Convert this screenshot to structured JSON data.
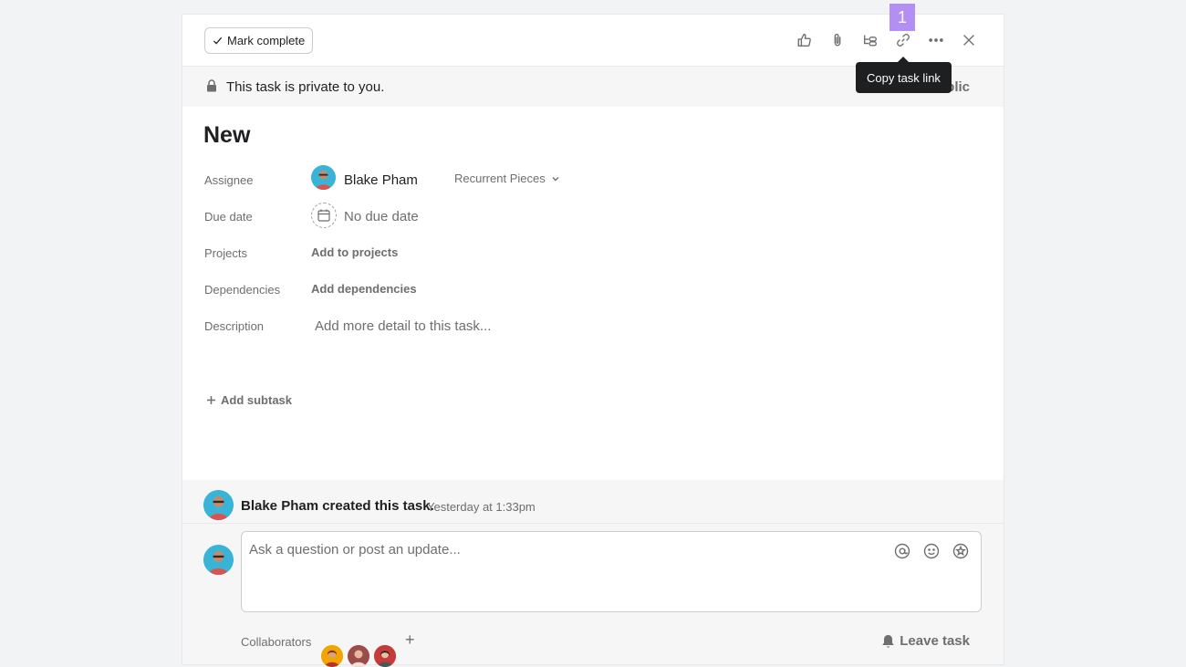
{
  "toolbar": {
    "mark_complete_label": "Mark complete",
    "marker_number": "1",
    "tooltip": "Copy task link",
    "icons": [
      "thumbs-up-icon",
      "paperclip-icon",
      "subtask-icon",
      "link-icon",
      "more-icon",
      "close-icon"
    ]
  },
  "banner": {
    "text": "This task is private to you.",
    "action_partial": "Make public"
  },
  "task": {
    "title": "New",
    "fields": {
      "assignee_label": "Assignee",
      "assignee_name": "Blake Pham",
      "project_selector": "Recurrent Pieces",
      "due_label": "Due date",
      "due_value": "No due date",
      "projects_label": "Projects",
      "projects_action": "Add to projects",
      "dependencies_label": "Dependencies",
      "dependencies_action": "Add dependencies",
      "description_label": "Description",
      "description_placeholder": "Add more detail to this task..."
    },
    "add_subtask": "Add subtask"
  },
  "feed": {
    "created_text": "Blake Pham created this task.",
    "created_time": "Yesterday at 1:33pm",
    "comment_placeholder": "Ask a question or post an update...",
    "collaborators_label": "Collaborators",
    "leave_task": "Leave task"
  },
  "colors": {
    "accent_marker": "#b38ef3",
    "avatar_bg": "#3ab4d6",
    "tooltip_bg": "#1e1f21"
  }
}
